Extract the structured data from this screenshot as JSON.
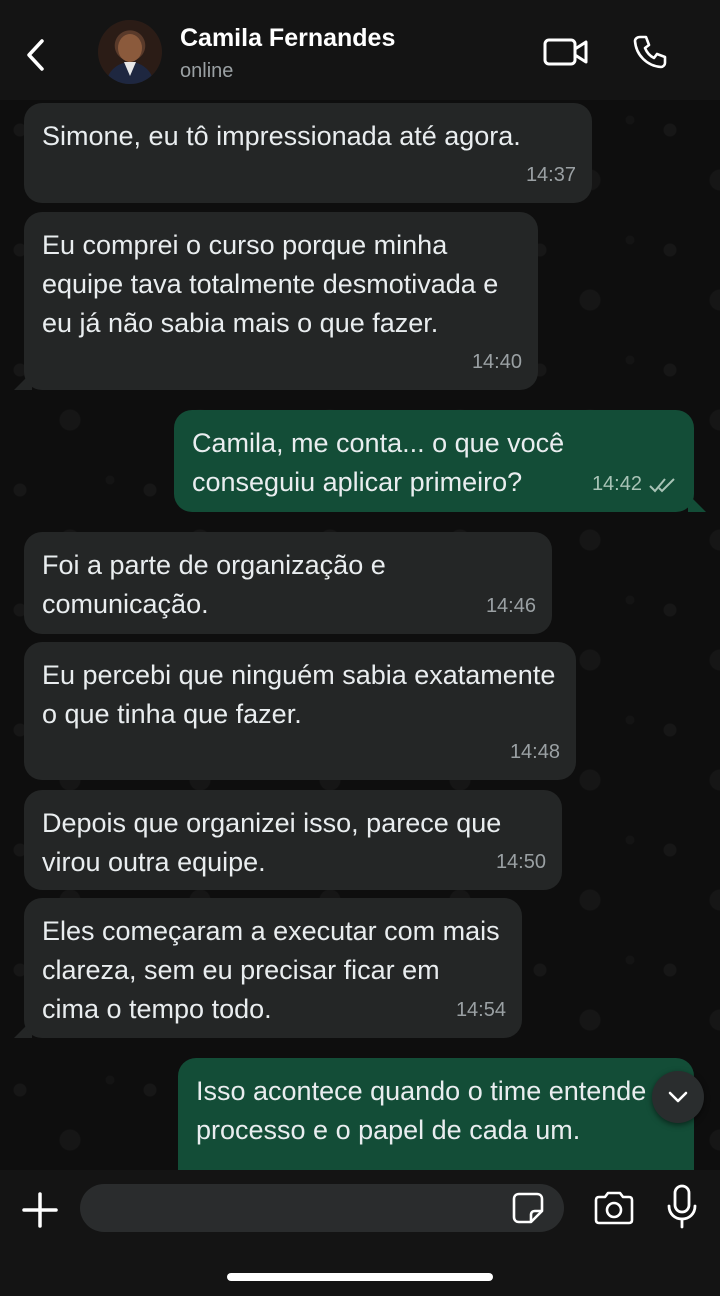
{
  "header": {
    "contact_name": "Camila Fernandes",
    "status": "online",
    "icons": {
      "back": "chevron-left-icon",
      "video": "video-camera-icon",
      "call": "phone-icon"
    }
  },
  "messages": [
    {
      "direction": "in",
      "text": "Simone, eu tô impressionada até agora.",
      "time": "14:37"
    },
    {
      "direction": "in",
      "text": "Eu comprei o curso porque minha equipe tava totalmente desmotivada e eu já não sabia mais o que fazer.",
      "time": "14:40"
    },
    {
      "direction": "out",
      "text": "Camila, me conta... o que você conseguiu aplicar primeiro?",
      "time": "14:42",
      "status": "read"
    },
    {
      "direction": "in",
      "text": "Foi a parte de organização e comunicação.",
      "time": "14:46"
    },
    {
      "direction": "in",
      "text": "Eu percebi que ninguém sabia exatamente o que tinha que fazer.",
      "time": "14:48"
    },
    {
      "direction": "in",
      "text": "Depois que organizei isso, parece que virou outra equipe.",
      "time": "14:50"
    },
    {
      "direction": "in",
      "text": "Eles começaram a executar com mais clareza, sem eu precisar ficar em cima o tempo todo.",
      "time": "14:54"
    },
    {
      "direction": "out",
      "text": "Isso acontece quando o time entende o processo e o papel de cada um.",
      "time": ""
    }
  ],
  "composer": {
    "input_value": "",
    "input_placeholder": "",
    "icons": {
      "attach": "plus-icon",
      "sticker": "sticker-icon",
      "camera": "camera-icon",
      "mic": "microphone-icon"
    }
  },
  "colors": {
    "incoming_bubble": "#242626",
    "outgoing_bubble": "#134d37",
    "read_ticks": "#9aa0a3"
  }
}
